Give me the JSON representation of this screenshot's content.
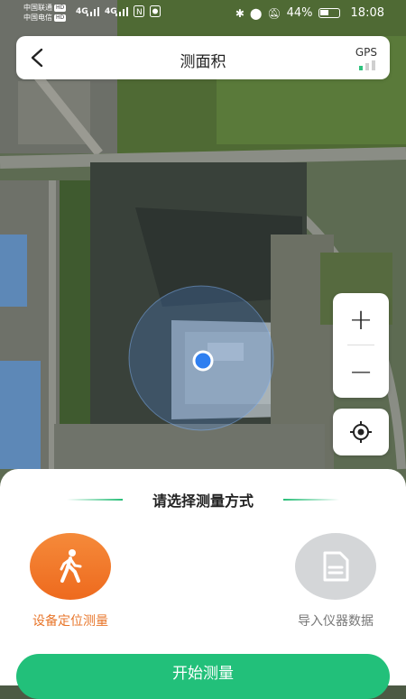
{
  "status_bar": {
    "carrier_1": "中国联通",
    "carrier_2": "中国电信",
    "hd_badge": "HD",
    "signal_1": "4G",
    "signal_2": "4G",
    "battery_percent": "44%",
    "time": "18:08"
  },
  "header": {
    "title": "测面积",
    "gps_label": "GPS",
    "gps_signal_level": 1,
    "gps_signal_max": 3,
    "back_icon": "back-arrow-icon"
  },
  "map_controls": {
    "zoom_in_label": "+",
    "zoom_out_label": "−",
    "locate_icon": "locate-icon"
  },
  "sheet": {
    "title": "请选择测量方式",
    "options": [
      {
        "label": "设备定位测量",
        "icon": "walking-person-icon",
        "selected": true
      },
      {
        "label": "导入仪器数据",
        "icon": "document-icon",
        "selected": false
      }
    ],
    "start_label": "开始测量"
  },
  "colors": {
    "accent_green": "#22c07a",
    "accent_orange": "#ee6a1e",
    "gps_active": "#2ec27e",
    "location_dot": "#2f7ff0"
  }
}
